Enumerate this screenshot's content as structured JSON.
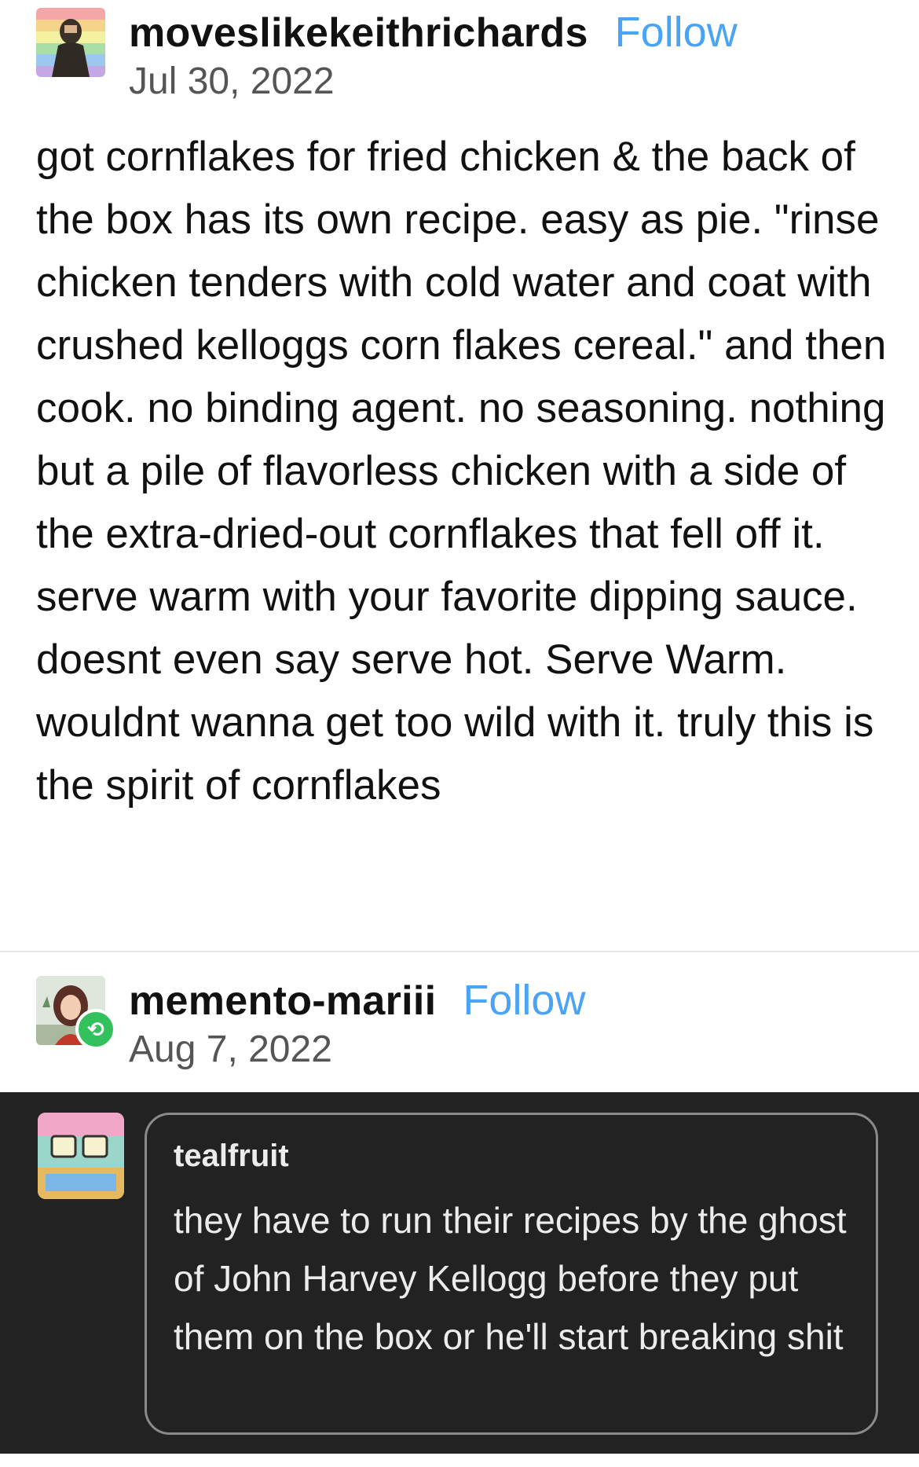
{
  "post": {
    "username": "moveslikekeithrichards",
    "follow_label": "Follow",
    "date": "Jul 30, 2022",
    "body": "got cornflakes for fried chicken & the back of the box has its own recipe. easy as pie. \"rinse chicken tenders with cold water and coat with crushed kelloggs corn flakes cereal.\" and then cook. no binding agent. no seasoning. nothing but a pile of flavorless chicken with a side of the extra-dried-out cornflakes that fell off it. serve warm with your favorite dipping sauce. doesnt even say serve hot. Serve Warm. wouldnt wanna get too wild with it. truly this is the spirit of cornflakes"
  },
  "reblog": {
    "username": "memento-mariii",
    "follow_label": "Follow",
    "date": "Aug 7, 2022",
    "badge_icon": "reblog-icon"
  },
  "reply": {
    "username": "tealfruit",
    "text": "they have to run their recipes by the ghost of John Harvey Kellogg before they put them on the box or he'll start breaking shit"
  },
  "colors": {
    "follow": "#4aa3f4",
    "reblog_badge": "#33c15e",
    "dark_panel": "#222222"
  }
}
